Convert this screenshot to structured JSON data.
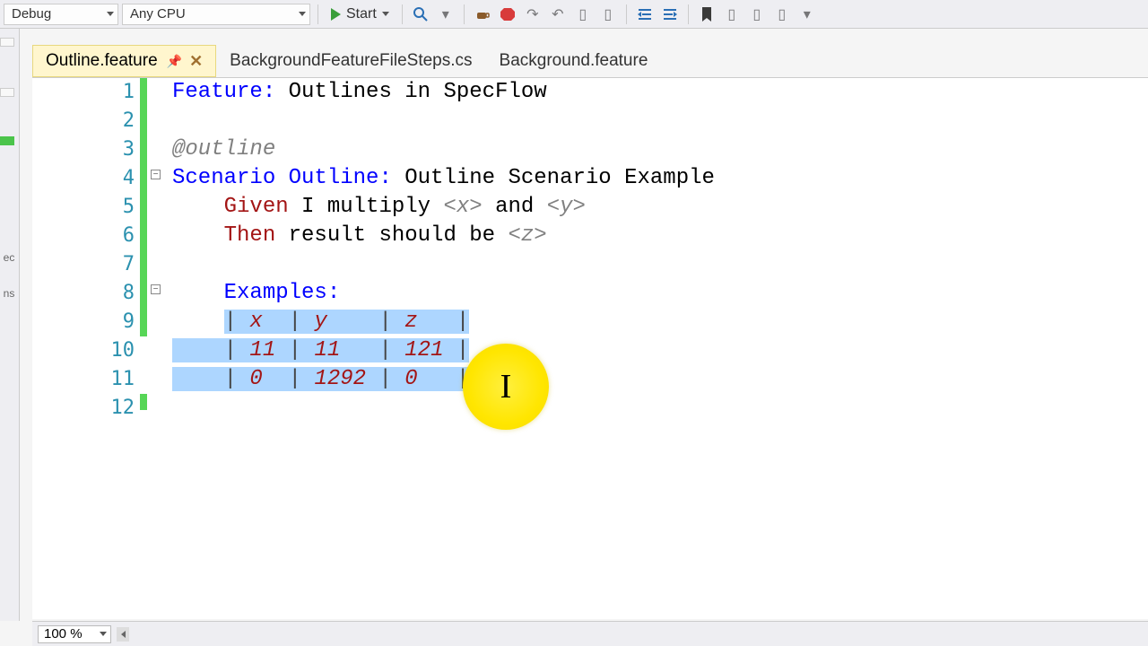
{
  "toolbar": {
    "config": "Debug",
    "platform": "Any CPU",
    "start": "Start"
  },
  "tabs": [
    {
      "label": "Outline.feature",
      "active": true
    },
    {
      "label": "BackgroundFeatureFileSteps.cs",
      "active": false
    },
    {
      "label": "Background.feature",
      "active": false
    }
  ],
  "editor": {
    "lines": {
      "1": {
        "kw": "Feature:",
        "rest": " Outlines in SpecFlow"
      },
      "3": {
        "tag": "@outline"
      },
      "4": {
        "kw": "Scenario Outline:",
        "rest": " Outline Scenario Example"
      },
      "5": {
        "kw": "Given",
        "pre": " I multiply ",
        "p1": "<x>",
        "mid": " and ",
        "p2": "<y>"
      },
      "6": {
        "kw": "Then",
        "pre": " result should be ",
        "p1": "<z>"
      },
      "8": {
        "kw": "Examples:"
      },
      "table": {
        "header": [
          "x",
          "y",
          "z"
        ],
        "rows": [
          [
            "11",
            "11",
            "121"
          ],
          [
            "0",
            "1292",
            "0"
          ]
        ]
      }
    },
    "line_numbers": [
      "1",
      "2",
      "3",
      "4",
      "5",
      "6",
      "7",
      "8",
      "9",
      "10",
      "11",
      "12"
    ]
  },
  "footer": {
    "zoom": "100 %"
  },
  "chart_data": null
}
